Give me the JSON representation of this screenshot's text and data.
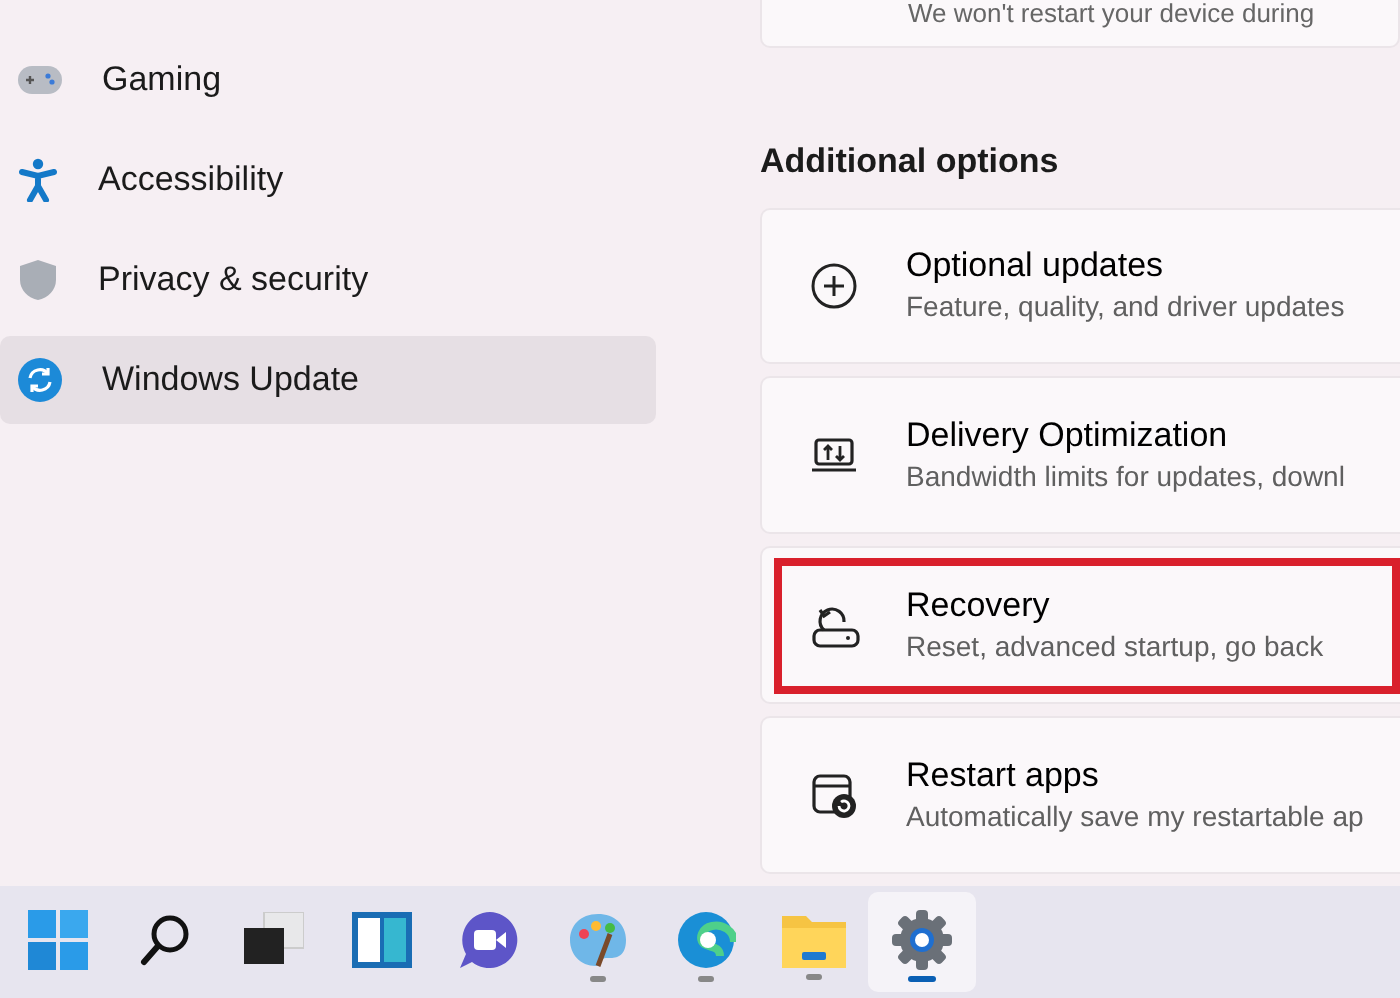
{
  "sidebar": {
    "items": [
      {
        "label": "Gaming",
        "selected": false
      },
      {
        "label": "Accessibility",
        "selected": false
      },
      {
        "label": "Privacy & security",
        "selected": false
      },
      {
        "label": "Windows Update",
        "selected": true
      }
    ]
  },
  "top_card": {
    "text": "We won't restart your device during"
  },
  "section_title": "Additional options",
  "options": [
    {
      "title": "Optional updates",
      "subtitle": "Feature, quality, and driver updates",
      "highlighted": false
    },
    {
      "title": "Delivery Optimization",
      "subtitle": "Bandwidth limits for updates, downl",
      "highlighted": false
    },
    {
      "title": "Recovery",
      "subtitle": "Reset, advanced startup, go back",
      "highlighted": true
    },
    {
      "title": "Restart apps",
      "subtitle": "Automatically save my restartable ap",
      "highlighted": false
    }
  ],
  "taskbar": [
    {
      "kind": "start",
      "running": false,
      "active": false
    },
    {
      "kind": "search",
      "running": false,
      "active": false
    },
    {
      "kind": "taskview",
      "running": false,
      "active": false
    },
    {
      "kind": "widgets",
      "running": false,
      "active": false
    },
    {
      "kind": "chat",
      "running": false,
      "active": false
    },
    {
      "kind": "paint",
      "running": true,
      "active": false
    },
    {
      "kind": "edge",
      "running": true,
      "active": false
    },
    {
      "kind": "folder",
      "running": true,
      "active": false
    },
    {
      "kind": "settings",
      "running": true,
      "active": true
    }
  ]
}
